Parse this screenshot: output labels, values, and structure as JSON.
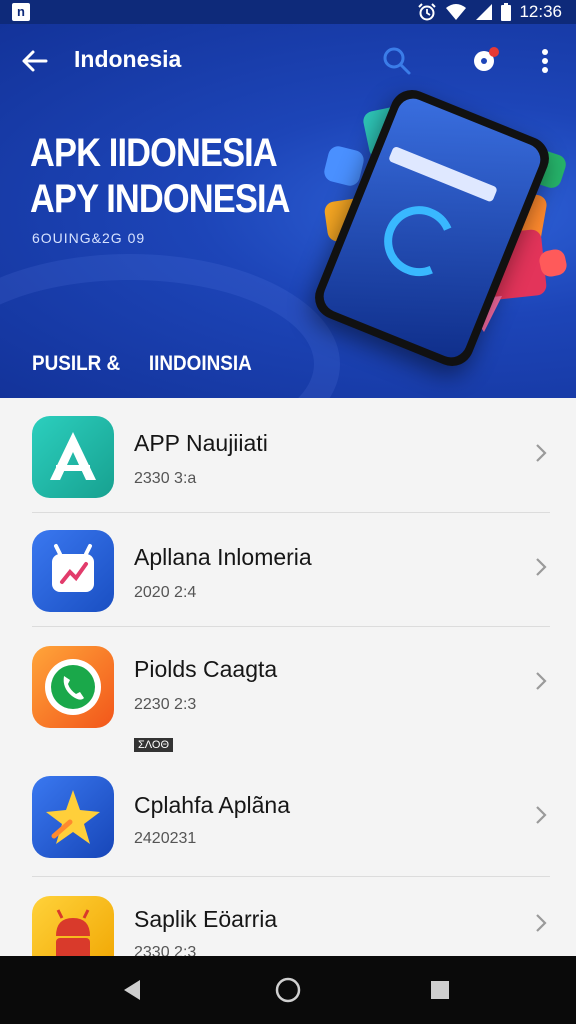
{
  "status_bar": {
    "left_icon_label": "n",
    "time": "12:36",
    "icons": [
      "alarm-icon",
      "wifi-icon",
      "signal-icon",
      "battery-icon"
    ]
  },
  "app_bar": {
    "title": "Indonesia",
    "icons": [
      "back-arrow-icon",
      "search-icon",
      "notification-badge-icon",
      "more-vert-icon"
    ]
  },
  "hero": {
    "title_line1": "APK IIDONESIA",
    "title_line2": "APY INDONESIA",
    "subtitle": "6OUING&2G 09",
    "tabs": [
      "PUSILR &",
      "IINDOINSIA"
    ]
  },
  "apps": [
    {
      "name": "APP Naujiiati",
      "date": "2330 3:a",
      "icon": "triangle-a-icon",
      "colors": [
        "#25c4b4",
        "#1aa596"
      ]
    },
    {
      "name": "Apllana Inlomeria",
      "date": "2020 2:4",
      "icon": "robot-chart-icon",
      "colors": [
        "#2f6be6",
        "#1a4fc2"
      ]
    },
    {
      "name": "Piolds Caagta",
      "date": "2230 2:3",
      "icon": "phone-call-icon",
      "colors": [
        "#ff9a2e",
        "#f25a1a"
      ],
      "tag": "ΣΛΟΘ"
    },
    {
      "name": "Cplahfa Aplãna",
      "date": "2420231",
      "icon": "star-icon",
      "colors": [
        "#2d6ae8",
        "#1746b8"
      ]
    },
    {
      "name": "Saplik Eöarria",
      "date": "2330 2:3",
      "icon": "android-icon",
      "colors": [
        "#ffcc2a",
        "#f0a400"
      ]
    }
  ],
  "nav_bar": {
    "buttons": [
      "back-triangle-icon",
      "home-circle-icon",
      "recents-square-icon"
    ]
  }
}
